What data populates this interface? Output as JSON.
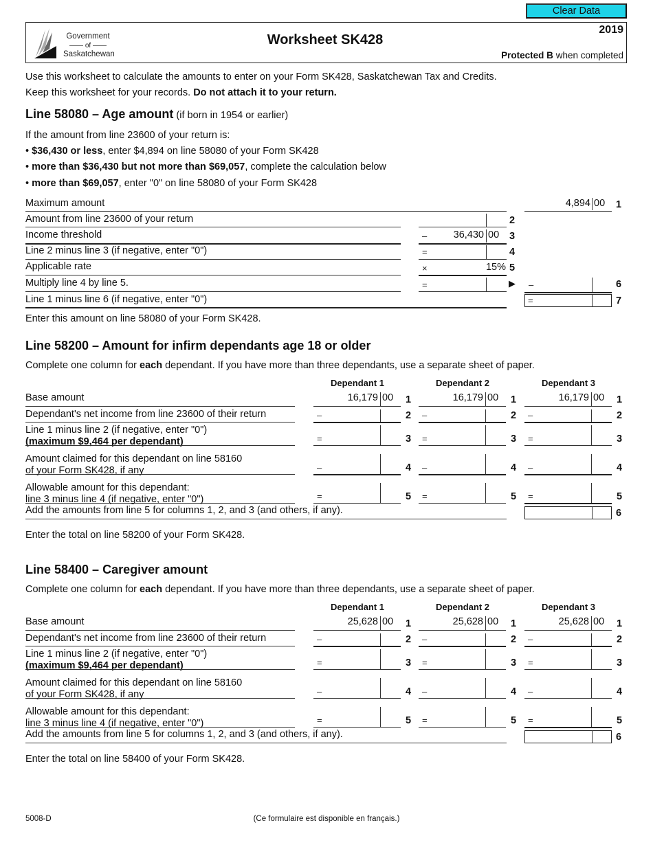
{
  "toolbar": {
    "clear_label": "Clear Data"
  },
  "header": {
    "logo": {
      "line1": "Government",
      "line2": "of",
      "line3": "Saskatchewan",
      "icon": "saskatchewan-logo-icon"
    },
    "title": "Worksheet SK428",
    "year": "2019",
    "protected_bold": "Protected B",
    "protected_rest": " when completed"
  },
  "intro": {
    "line1": "Use this worksheet to calculate the amounts to enter on your Form SK428, Saskatchewan Tax and Credits.",
    "line2_plain": "Keep this worksheet for your records. ",
    "line2_bold": "Do not attach it to your return."
  },
  "age": {
    "title": "Line 58080 – Age amount",
    "subtitle": " (if born in 1954 or earlier)",
    "lead": "If the amount from line 23600 of your return is:",
    "bullets": [
      {
        "bold": "$36,430 or less",
        "rest": ", enter $4,894 on line 58080 of your Form SK428"
      },
      {
        "bold": "more than $36,430 but not more than $69,057",
        "rest": ", complete the calculation below"
      },
      {
        "bold": "more than $69,057",
        "rest": ", enter \"0\" on line 58080 of your Form SK428"
      }
    ],
    "rows": [
      {
        "label": "Maximum amount",
        "num": "1",
        "dollars": "4,894",
        "cents": "00"
      },
      {
        "label": "Amount from line 23600 of your return",
        "num": "2"
      },
      {
        "label": "Income threshold",
        "num": "3",
        "op": "–",
        "dollars": "36,430",
        "cents": "00"
      },
      {
        "label": "Line 2 minus line 3 (if negative, enter \"0\")",
        "num": "4",
        "op": "="
      },
      {
        "label": "Applicable rate",
        "num": "5",
        "op": "×",
        "rate": "15%"
      },
      {
        "label": "Multiply line 4 by line 5.",
        "num": "6",
        "op": "=",
        "op_right": "–"
      },
      {
        "label": "Line 1 minus line 6 (if negative, enter \"0\")",
        "num": "7",
        "op_right": "="
      }
    ],
    "note": "Enter this amount on line 58080 of your Form SK428."
  },
  "infirm": {
    "title": "Line 58200 – Amount for infirm dependants age 18 or older",
    "lead_a": "Complete one column for ",
    "lead_bold": "each",
    "lead_b": " dependant. If you have more than three dependants, use a separate sheet of paper.",
    "columns": [
      "Dependant 1",
      "Dependant 2",
      "Dependant 3"
    ],
    "base_dollars": "16,179",
    "base_cents": "00",
    "rows": [
      {
        "label1": "Base amount",
        "num": "1"
      },
      {
        "label1": "Dependant's net income from line 23600 of their return",
        "num": "2",
        "op": "–"
      },
      {
        "label1": "Line 1 minus line 2 (if negative, enter \"0\")",
        "label2": "(maximum $9,464 per dependant)",
        "num": "3",
        "op": "="
      },
      {
        "label1": "Amount claimed for this dependant on line 58160",
        "label2": "of your Form SK428, if any",
        "num": "4",
        "op": "–"
      },
      {
        "label1": "Allowable amount for this dependant:",
        "label2": "line 3 minus line 4 (if negative, enter \"0\")",
        "num": "5",
        "op": "="
      }
    ],
    "total_label": "Add the amounts from line 5 for columns 1, 2, and 3 (and others, if any).",
    "total_num": "6",
    "note": "Enter the total on line 58200 of your Form SK428."
  },
  "caregiver": {
    "title": "Line 58400 – Caregiver amount",
    "lead_a": "Complete one column for ",
    "lead_bold": "each",
    "lead_b": " dependant. If you have more than three dependants, use a separate sheet of paper.",
    "columns": [
      "Dependant 1",
      "Dependant 2",
      "Dependant 3"
    ],
    "base_dollars": "25,628",
    "base_cents": "00",
    "rows": [
      {
        "label1": "Base amount",
        "num": "1"
      },
      {
        "label1": "Dependant's net income from line 23600 of their return",
        "num": "2",
        "op": "–"
      },
      {
        "label1": "Line 1 minus line 2 (if negative, enter \"0\")",
        "label2": "(maximum $9,464 per dependant)",
        "num": "3",
        "op": "="
      },
      {
        "label1": "Amount claimed for this dependant on line 58160",
        "label2": "of your Form SK428, if any",
        "num": "4",
        "op": "–"
      },
      {
        "label1": "Allowable amount for this dependant:",
        "label2": "line 3 minus line 4 (if negative, enter \"0\")",
        "num": "5",
        "op": "="
      }
    ],
    "total_label": "Add the amounts from line 5 for columns 1, 2, and 3 (and others, if any).",
    "total_num": "6",
    "note": "Enter the total on line 58400 of your Form SK428."
  },
  "footer": {
    "form_code": "5008-D",
    "french": "(Ce formulaire est disponible en français.)"
  }
}
